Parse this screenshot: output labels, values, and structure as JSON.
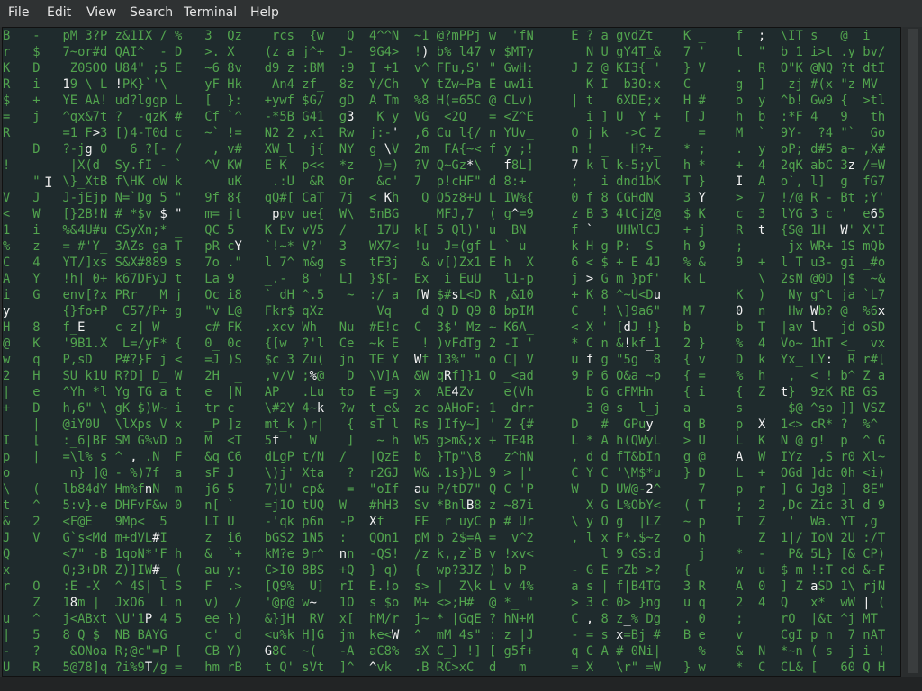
{
  "menu": {
    "file": "File",
    "edit": "Edit",
    "view": "View",
    "search": "Search",
    "terminal": "Terminal",
    "help": "Help"
  },
  "terminal": {
    "rain_color": "#52a44e",
    "highlight_color": "#f2f2f2",
    "background": "#1f2b2d",
    "text_cursor_icon": "I-beam"
  }
}
